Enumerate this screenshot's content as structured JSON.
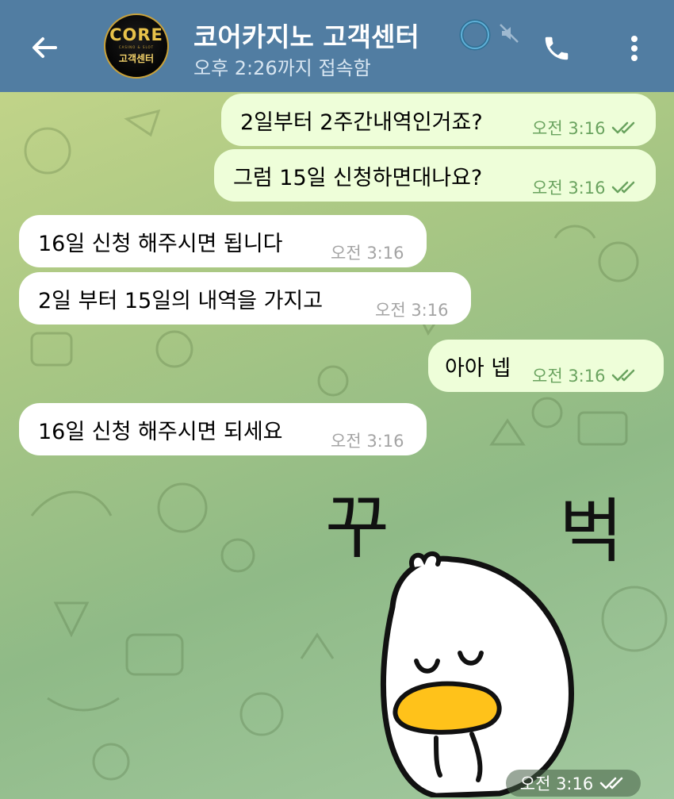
{
  "header": {
    "title": "코어카지노 고객센터",
    "status": "오후 2:26까지 접속함",
    "avatar": {
      "logo": "CORE",
      "tagline": "CASINO & SLOT",
      "sub": "고객센터"
    },
    "icons": [
      "arrow-left-icon",
      "ring-status-icon",
      "mute-icon",
      "phone-icon",
      "more-vert-icon"
    ],
    "colors": {
      "bar": "#517da2",
      "outgoing": "#eefed9",
      "incoming": "#ffffff",
      "read_check": "#6aa35f"
    }
  },
  "messages": [
    {
      "dir": "out",
      "text": "2일부터 2주간내역인거죠?",
      "time": "오전 3:16",
      "read": true
    },
    {
      "dir": "out",
      "text": "그럼 15일 신청하면대나요?",
      "time": "오전 3:16",
      "read": true
    },
    {
      "dir": "in",
      "text": "16일 신청 해주시면 됩니다",
      "time": "오전 3:16"
    },
    {
      "dir": "in",
      "text": "2일 부터 15일의 내역을 가지고",
      "time": "오전 3:16"
    },
    {
      "dir": "out",
      "text": "아아 넵",
      "time": "오전 3:16",
      "read": true
    },
    {
      "dir": "in",
      "text": "16일 신청 해주시면 되세요",
      "time": "오전 3:16"
    }
  ],
  "sticker": {
    "text_left": "꾸",
    "text_right": "벅",
    "time": "오전 3:16",
    "read": true
  }
}
